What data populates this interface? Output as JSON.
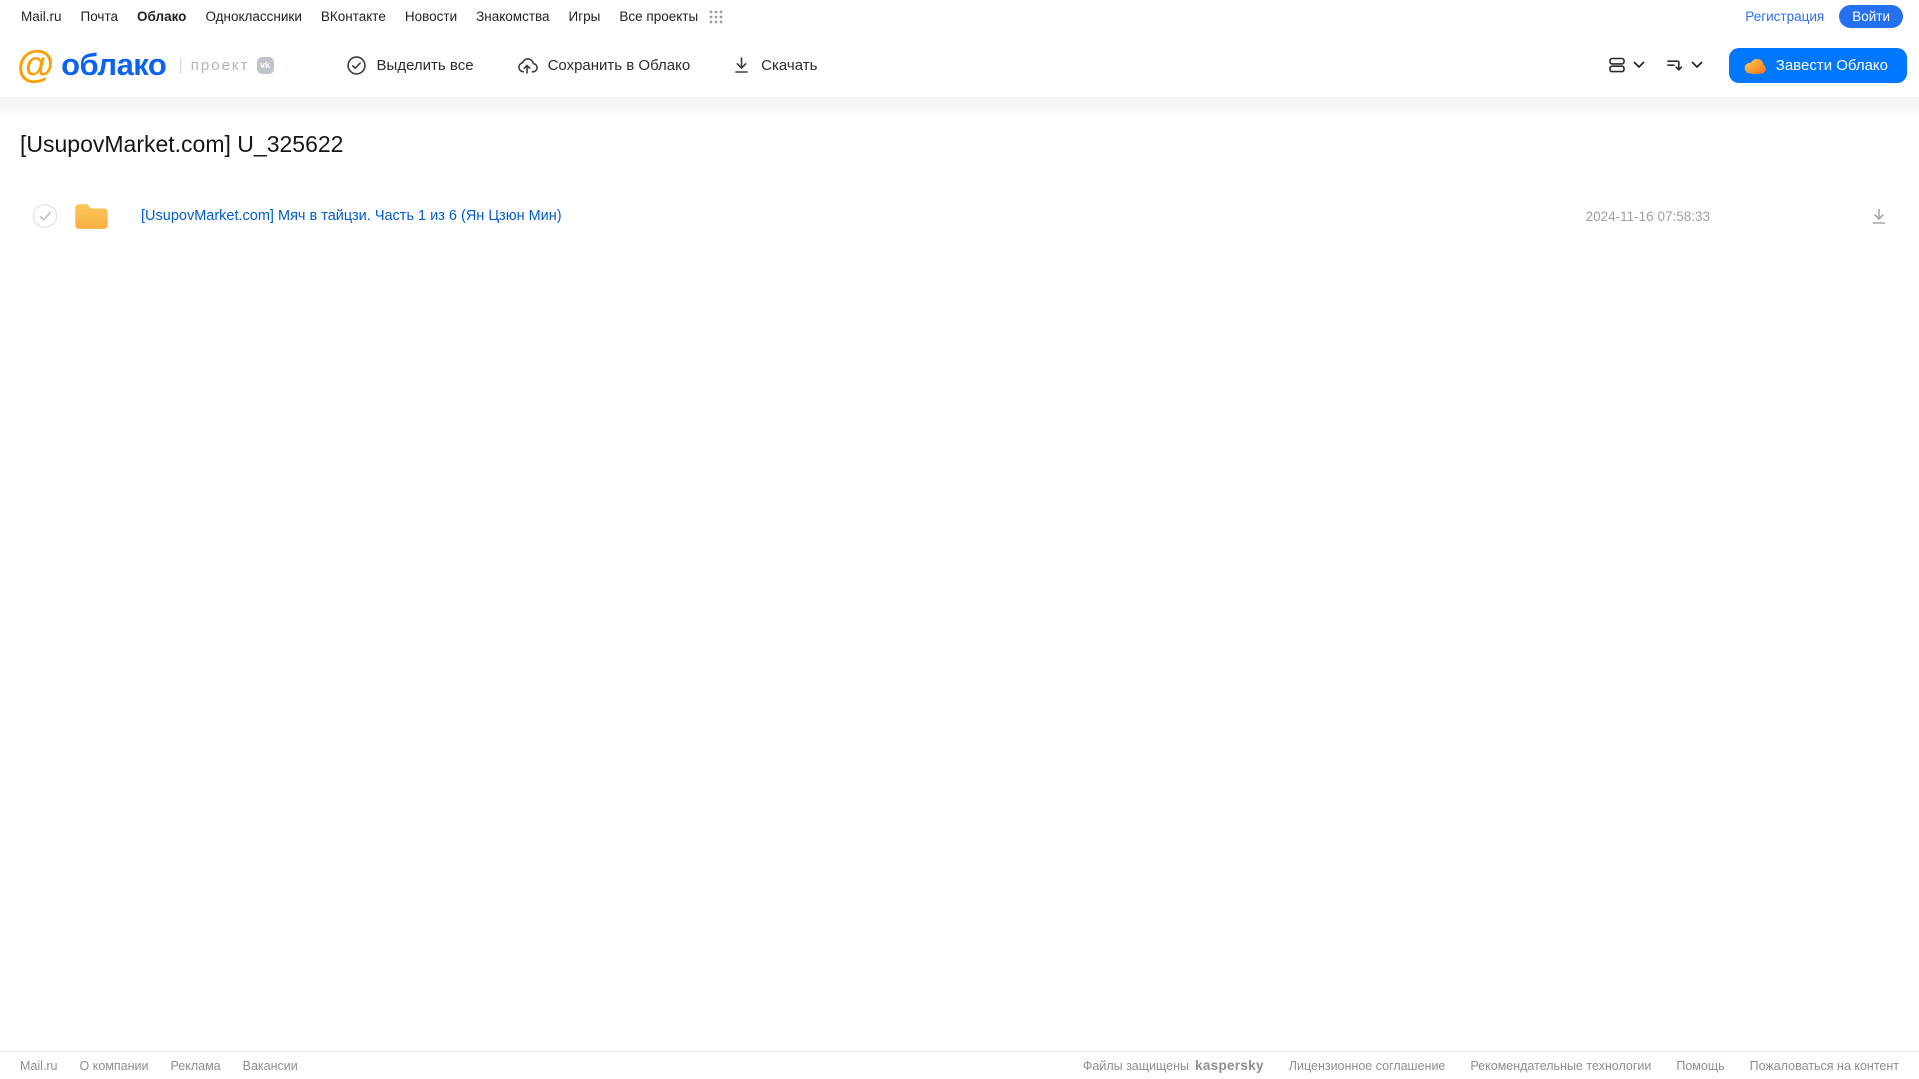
{
  "topnav": {
    "items": [
      {
        "label": "Mail.ru",
        "active": false
      },
      {
        "label": "Почта",
        "active": false
      },
      {
        "label": "Облако",
        "active": true
      },
      {
        "label": "Одноклассники",
        "active": false
      },
      {
        "label": "ВКонтакте",
        "active": false
      },
      {
        "label": "Новости",
        "active": false
      },
      {
        "label": "Знакомства",
        "active": false
      },
      {
        "label": "Игры",
        "active": false
      },
      {
        "label": "Все проекты",
        "active": false
      }
    ],
    "register_label": "Регистрация",
    "login_label": "Войти"
  },
  "header": {
    "logo_at": "@",
    "logo_word": "облако",
    "separator": "|",
    "project_label": "проект",
    "vk_badge_text": "vk",
    "actions": {
      "select_all": "Выделить все",
      "save_to_cloud": "Сохранить в Облако",
      "download": "Скачать"
    },
    "get_cloud_label": "Завести Облако"
  },
  "main": {
    "title": "[UsupovMarket.com] U_325622",
    "files": [
      {
        "name": "[UsupovMarket.com] Мяч в тайцзи. Часть 1 из 6 (Ян Цзюн Мин)",
        "date": "2024-11-16 07:58:33",
        "type": "folder"
      }
    ]
  },
  "footer": {
    "left_links": [
      "Mail.ru",
      "О компании",
      "Реклама",
      "Вакансии"
    ],
    "protected_label": "Файлы защищены",
    "kaspersky_label": "kaspersky",
    "right_links": [
      "Лицензионное соглашение",
      "Рекомендательные технологии",
      "Помощь",
      "Пожаловаться на контент"
    ]
  },
  "colors": {
    "accent_blue": "#0077ff",
    "login_blue": "#2470ee",
    "logo_blue": "#0b63f0",
    "logo_orange": "#ff9e00",
    "folder_amber": "#fbbd4d",
    "link_blue": "#005bd1",
    "kaspersky_green": "#00a88e",
    "muted_gray": "#9f9f9f"
  }
}
